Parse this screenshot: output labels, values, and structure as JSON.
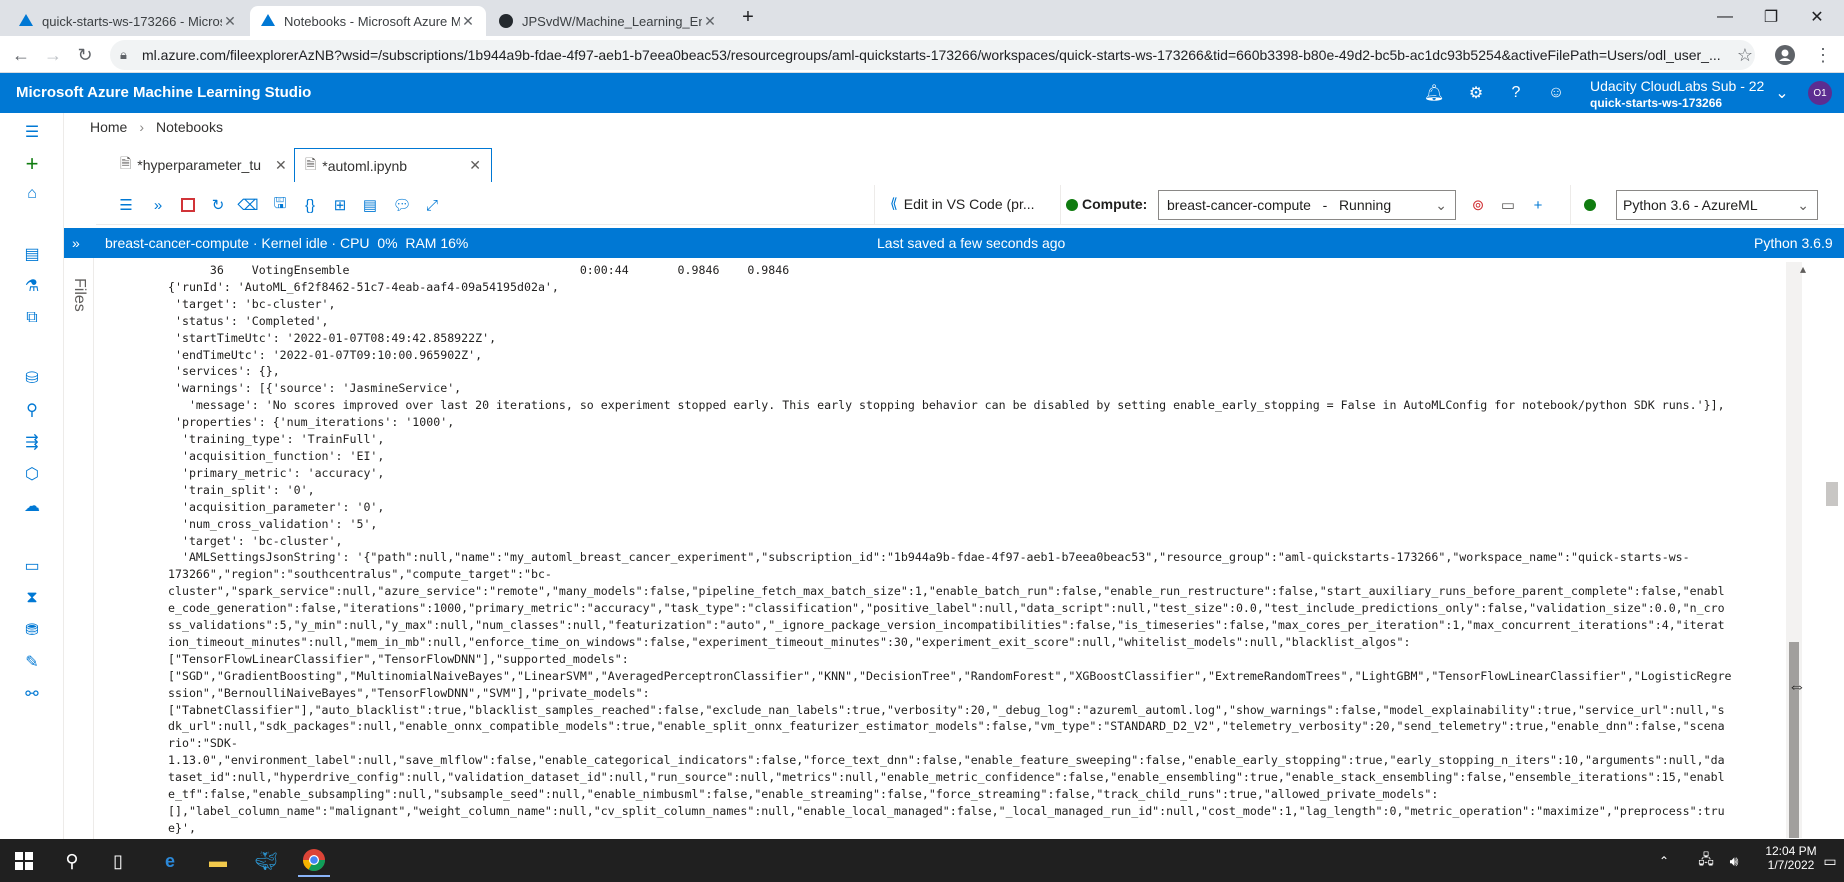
{
  "browser": {
    "tabs": [
      {
        "title": "quick-starts-ws-173266 - Micros"
      },
      {
        "title": "Notebooks - Microsoft Azure Ma"
      },
      {
        "title": "JPSvdW/Machine_Learning_Engi"
      }
    ],
    "url": "ml.azure.com/fileexplorerAzNB?wsid=/subscriptions/1b944a9b-fdae-4f97-aeb1-b7eea0beac53/resourcegroups/aml-quickstarts-173266/workspaces/quick-starts-ws-173266&tid=660b3398-b80e-49d2-bc5b-ac1dc93b5254&activeFilePath=Users/odl_user_..."
  },
  "header": {
    "title": "Microsoft Azure Machine Learning Studio",
    "account_name": "Udacity CloudLabs Sub - 22",
    "workspace": "quick-starts-ws-173266",
    "avatar_initials": "O1"
  },
  "breadcrumb": [
    "Home",
    "Notebooks"
  ],
  "notebook_tabs": [
    {
      "label": "*hyperparameter_tu"
    },
    {
      "label": "*automl.ipynb"
    }
  ],
  "toolbar": {
    "vscode_label": "Edit in VS Code (pr...",
    "compute_label": "Compute:",
    "compute_value": "breast-cancer-compute   -   Running",
    "kernel_value": "Python 3.6 - AzureML"
  },
  "status": {
    "left": "breast-cancer-compute · Kernel idle · CPU  0%  RAM 16%",
    "center": "Last saved a few seconds ago",
    "right": "Python 3.6.9"
  },
  "files_label": "Files",
  "output_lines": [
    "      36    VotingEnsemble                                 0:00:44       0.9846    0.9846",
    "{'runId': 'AutoML_6f2f8462-51c7-4eab-aaf4-09a54195d02a',",
    " 'target': 'bc-cluster',",
    " 'status': 'Completed',",
    " 'startTimeUtc': '2022-01-07T08:49:42.858922Z',",
    " 'endTimeUtc': '2022-01-07T09:10:00.965902Z',",
    " 'services': {},",
    " 'warnings': [{'source': 'JasmineService',",
    "   'message': 'No scores improved over last 20 iterations, so experiment stopped early. This early stopping behavior can be disabled by setting enable_early_stopping = False in AutoMLConfig for notebook/python SDK runs.'}],",
    " 'properties': {'num_iterations': '1000',",
    "  'training_type': 'TrainFull',",
    "  'acquisition_function': 'EI',",
    "  'primary_metric': 'accuracy',",
    "  'train_split': '0',",
    "  'acquisition_parameter': '0',",
    "  'num_cross_validation': '5',",
    "  'target': 'bc-cluster',",
    "  'AMLSettingsJsonString': '{\"path\":null,\"name\":\"my_automl_breast_cancer_experiment\",\"subscription_id\":\"1b944a9b-fdae-4f97-aeb1-b7eea0beac53\",\"resource_group\":\"aml-quickstarts-173266\",\"workspace_name\":\"quick-starts-ws-",
    "173266\",\"region\":\"southcentralus\",\"compute_target\":\"bc-",
    "cluster\",\"spark_service\":null,\"azure_service\":\"remote\",\"many_models\":false,\"pipeline_fetch_max_batch_size\":1,\"enable_batch_run\":false,\"enable_run_restructure\":false,\"start_auxiliary_runs_before_parent_complete\":false,\"enabl",
    "e_code_generation\":false,\"iterations\":1000,\"primary_metric\":\"accuracy\",\"task_type\":\"classification\",\"positive_label\":null,\"data_script\":null,\"test_size\":0.0,\"test_include_predictions_only\":false,\"validation_size\":0.0,\"n_cro",
    "ss_validations\":5,\"y_min\":null,\"y_max\":null,\"num_classes\":null,\"featurization\":\"auto\",\"_ignore_package_version_incompatibilities\":false,\"is_timeseries\":false,\"max_cores_per_iteration\":1,\"max_concurrent_iterations\":4,\"iterat",
    "ion_timeout_minutes\":null,\"mem_in_mb\":null,\"enforce_time_on_windows\":false,\"experiment_timeout_minutes\":30,\"experiment_exit_score\":null,\"whitelist_models\":null,\"blacklist_algos\":",
    "[\"TensorFlowLinearClassifier\",\"TensorFlowDNN\"],\"supported_models\":",
    "[\"SGD\",\"GradientBoosting\",\"MultinomialNaiveBayes\",\"LinearSVM\",\"AveragedPerceptronClassifier\",\"KNN\",\"DecisionTree\",\"RandomForest\",\"XGBoostClassifier\",\"ExtremeRandomTrees\",\"LightGBM\",\"TensorFlowLinearClassifier\",\"LogisticRegre",
    "ssion\",\"BernoulliNaiveBayes\",\"TensorFlowDNN\",\"SVM\"],\"private_models\":",
    "[\"TabnetClassifier\"],\"auto_blacklist\":true,\"blacklist_samples_reached\":false,\"exclude_nan_labels\":true,\"verbosity\":20,\"_debug_log\":\"azureml_automl.log\",\"show_warnings\":false,\"model_explainability\":true,\"service_url\":null,\"s",
    "dk_url\":null,\"sdk_packages\":null,\"enable_onnx_compatible_models\":true,\"enable_split_onnx_featurizer_estimator_models\":false,\"vm_type\":\"STANDARD_D2_V2\",\"telemetry_verbosity\":20,\"send_telemetry\":true,\"enable_dnn\":false,\"scena",
    "rio\":\"SDK-",
    "1.13.0\",\"environment_label\":null,\"save_mlflow\":false,\"enable_categorical_indicators\":false,\"force_text_dnn\":false,\"enable_feature_sweeping\":false,\"enable_early_stopping\":true,\"early_stopping_n_iters\":10,\"arguments\":null,\"da",
    "taset_id\":null,\"hyperdrive_config\":null,\"validation_dataset_id\":null,\"run_source\":null,\"metrics\":null,\"enable_metric_confidence\":false,\"enable_ensembling\":true,\"enable_stack_ensembling\":false,\"ensemble_iterations\":15,\"enabl",
    "e_tf\":false,\"enable_subsampling\":null,\"subsample_seed\":null,\"enable_nimbusml\":false,\"enable_streaming\":false,\"force_streaming\":false,\"track_child_runs\":true,\"allowed_private_models\":",
    "[],\"label_column_name\":\"malignant\",\"weight_column_name\":null,\"cv_split_column_names\":null,\"enable_local_managed\":false,\"_local_managed_run_id\":null,\"cost_mode\":1,\"lag_length\":0,\"metric_operation\":\"maximize\",\"preprocess\":tru",
    "e}',"
  ],
  "taskbar": {
    "time": "12:04 PM",
    "date": "1/7/2022"
  },
  "colors": {
    "azure_blue": "#0078d4",
    "tab_strip": "#dee1e6",
    "taskbar": "#202020",
    "running_green": "#107c10",
    "stop_red": "#d13438"
  }
}
